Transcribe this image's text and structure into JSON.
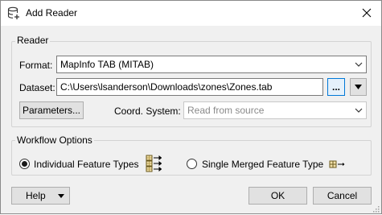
{
  "window": {
    "title": "Add Reader",
    "title_icon": "database-add-icon",
    "close_icon": "close-icon"
  },
  "reader": {
    "group_label": "Reader",
    "format_label": "Format:",
    "format_value": "MapInfo TAB (MITAB)",
    "dataset_label": "Dataset:",
    "dataset_value": "C:\\Users\\lsanderson\\Downloads\\zones\\Zones.tab",
    "browse_label": "...",
    "parameters_label": "Parameters...",
    "coord_label": "Coord. System:",
    "coord_placeholder": "Read from source"
  },
  "workflow": {
    "group_label": "Workflow Options",
    "option_individual": "Individual Feature Types",
    "option_merged": "Single Merged Feature Type",
    "selected": "individual"
  },
  "footer": {
    "help_label": "Help",
    "ok_label": "OK",
    "cancel_label": "Cancel"
  }
}
